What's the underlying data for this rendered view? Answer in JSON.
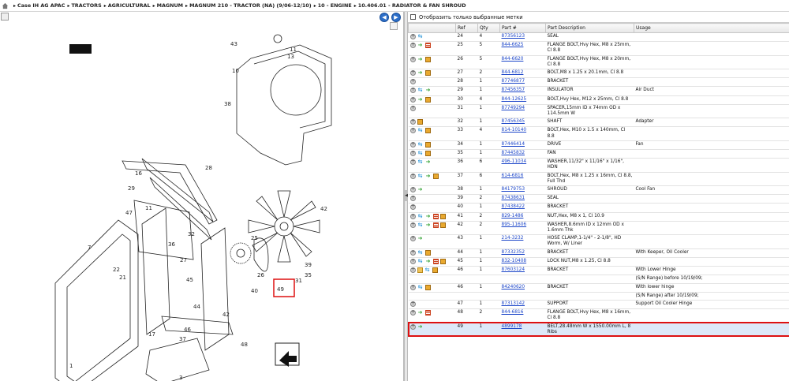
{
  "breadcrumb": [
    "Case IH AG APAC",
    "TRACTORS",
    "AGRICULTURAL",
    "MAGNUM",
    "MAGNUM 210 - TRACTOR (NA) (9/06-12/10)",
    "10 - ENGINE",
    "10.406.01 - RADIATOR & FAN SHROUD"
  ],
  "left": {
    "nav_prev": "◀",
    "nav_next": "▶",
    "callouts": [
      "43",
      "10",
      "11",
      "13",
      "38",
      "28",
      "16",
      "29",
      "47",
      "11",
      "32",
      "36",
      "27",
      "45",
      "17",
      "22",
      "21",
      "46",
      "42",
      "44",
      "25",
      "26",
      "40",
      "7",
      "49",
      "39",
      "42",
      "35",
      "31",
      "48",
      "1",
      "37",
      "3"
    ]
  },
  "right": {
    "filter_label": "Отобразить только выбранные метки",
    "columns": [
      "",
      "Ref",
      "Qty",
      "Part #",
      "Part Description",
      "Usage"
    ],
    "rows": [
      {
        "icons": [
          "add",
          "swap"
        ],
        "ref": "24",
        "qty": "4",
        "part": "87356123",
        "desc": "SEAL",
        "usage": ""
      },
      {
        "icons": [
          "add",
          "go",
          "list"
        ],
        "ref": "25",
        "qty": "5",
        "part": "844-6625",
        "desc": "FLANGE BOLT,Hvy Hex, M8 x 25mm, Cl 8.8",
        "usage": ""
      },
      {
        "icons": [
          "add",
          "go",
          "box"
        ],
        "ref": "26",
        "qty": "5",
        "part": "844-6620",
        "desc": "FLANGE BOLT,Hvy Hex, M8 x 20mm, Cl 8.8",
        "usage": ""
      },
      {
        "icons": [
          "add",
          "go",
          "box"
        ],
        "ref": "27",
        "qty": "2",
        "part": "844-6812",
        "desc": "BOLT,M8 x 1.25 x 20.1mm, Cl 8.8",
        "usage": ""
      },
      {
        "icons": [
          "add"
        ],
        "ref": "28",
        "qty": "1",
        "part": "87746877",
        "desc": "BRACKET",
        "usage": ""
      },
      {
        "icons": [
          "add",
          "swap",
          "go"
        ],
        "ref": "29",
        "qty": "1",
        "part": "87456357",
        "desc": "INSULATOR",
        "usage": "Air Duct"
      },
      {
        "icons": [
          "add",
          "go",
          "box"
        ],
        "ref": "30",
        "qty": "4",
        "part": "844-12625",
        "desc": "BOLT,Hvy Hex, M12 x 25mm, Cl 8.8",
        "usage": ""
      },
      {
        "icons": [
          "add"
        ],
        "ref": "31",
        "qty": "1",
        "part": "87749294",
        "desc": "SPACER,15mm ID x 74mm OD x 114.5mm W",
        "usage": ""
      },
      {
        "icons": [
          "add",
          "box"
        ],
        "ref": "32",
        "qty": "1",
        "part": "87456345",
        "desc": "SHAFT",
        "usage": "Adapter"
      },
      {
        "icons": [
          "add",
          "swap",
          "box"
        ],
        "ref": "33",
        "qty": "4",
        "part": "814-10140",
        "desc": "BOLT,Hex, M10 x 1.5 x 140mm, Cl 8.8",
        "usage": ""
      },
      {
        "icons": [
          "add",
          "swap",
          "box"
        ],
        "ref": "34",
        "qty": "1",
        "part": "87446414",
        "desc": "DRIVE",
        "usage": "Fan"
      },
      {
        "icons": [
          "add",
          "swap",
          "box"
        ],
        "ref": "35",
        "qty": "1",
        "part": "87445832",
        "desc": "FAN",
        "usage": ""
      },
      {
        "icons": [
          "add",
          "swap",
          "go"
        ],
        "ref": "36",
        "qty": "6",
        "part": "496-11034",
        "desc": "WASHER,11/32\" x 11/16\" x 1/16\", HDN",
        "usage": ""
      },
      {
        "icons": [
          "add",
          "swap",
          "go",
          "box"
        ],
        "ref": "37",
        "qty": "6",
        "part": "614-6816",
        "desc": "BOLT,Hex, M8 x 1.25 x 16mm, Cl 8.8, Full Thd",
        "usage": ""
      },
      {
        "icons": [
          "add",
          "go"
        ],
        "ref": "38",
        "qty": "1",
        "part": "84179753",
        "desc": "SHROUD",
        "usage": "Cool Fan"
      },
      {
        "icons": [
          "add"
        ],
        "ref": "39",
        "qty": "2",
        "part": "87438631",
        "desc": "SEAL",
        "usage": ""
      },
      {
        "icons": [
          "add"
        ],
        "ref": "40",
        "qty": "1",
        "part": "87438422",
        "desc": "BRACKET",
        "usage": ""
      },
      {
        "icons": [
          "add",
          "swap",
          "go",
          "list",
          "box"
        ],
        "ref": "41",
        "qty": "2",
        "part": "829-1486",
        "desc": "NUT,Hex, M8 x 1, Cl 10.9",
        "usage": ""
      },
      {
        "icons": [
          "add",
          "swap",
          "go",
          "list",
          "box"
        ],
        "ref": "42",
        "qty": "2",
        "part": "895-11606",
        "desc": "WASHER,8.6mm ID x 12mm OD x 1.6mm Thk",
        "usage": ""
      },
      {
        "icons": [
          "add",
          "go"
        ],
        "ref": "43",
        "qty": "1",
        "part": "214-3232",
        "desc": "HOSE CLAMP,1-1/4\" - 2-1/8\", HD Worm, W/ Liner",
        "usage": ""
      },
      {
        "icons": [
          "add",
          "swap",
          "box"
        ],
        "ref": "44",
        "qty": "1",
        "part": "87332352",
        "desc": "BRACKET",
        "usage": "With Keeper, Oil Cooler"
      },
      {
        "icons": [
          "add",
          "swap",
          "go",
          "list",
          "box"
        ],
        "ref": "45",
        "qty": "1",
        "part": "832-10408",
        "desc": "LOCK NUT,M8 x 1.25, Cl 8.8",
        "usage": ""
      },
      {
        "icons": [
          "add",
          "folder",
          "swap",
          "box"
        ],
        "ref": "46",
        "qty": "1",
        "part": "87603124",
        "desc": "BRACKET",
        "usage": "With Lower Hinge"
      },
      {
        "icons": [],
        "ref": "",
        "qty": "",
        "part": "",
        "desc": "",
        "usage": "(S/N Range) before 10/19/09;"
      },
      {
        "icons": [
          "add",
          "swap",
          "box"
        ],
        "ref": "46",
        "qty": "1",
        "part": "84240620",
        "desc": "BRACKET",
        "usage": "With lower hinge"
      },
      {
        "icons": [],
        "ref": "",
        "qty": "",
        "part": "",
        "desc": "",
        "usage": "(S/N Range) after 10/19/09;"
      },
      {
        "icons": [
          "add"
        ],
        "ref": "47",
        "qty": "1",
        "part": "87313142",
        "desc": "SUPPORT",
        "usage": "Support Oil Cooler Hinge"
      },
      {
        "icons": [
          "add",
          "go",
          "list"
        ],
        "ref": "48",
        "qty": "2",
        "part": "844-6816",
        "desc": "FLANGE BOLT,Hvy Hex, M8 x 16mm, Cl 8.8",
        "usage": ""
      },
      {
        "icons": [
          "add",
          "go"
        ],
        "ref": "49",
        "qty": "1",
        "part": "4899178",
        "desc": "BELT,28.48mm W x 1550.00mm L, 8 Ribs",
        "usage": "",
        "selected": true
      }
    ]
  },
  "colors": {
    "link": "#1a44c8",
    "selected_row_outline": "#dd1111",
    "nav_button": "#2d6fc9"
  }
}
